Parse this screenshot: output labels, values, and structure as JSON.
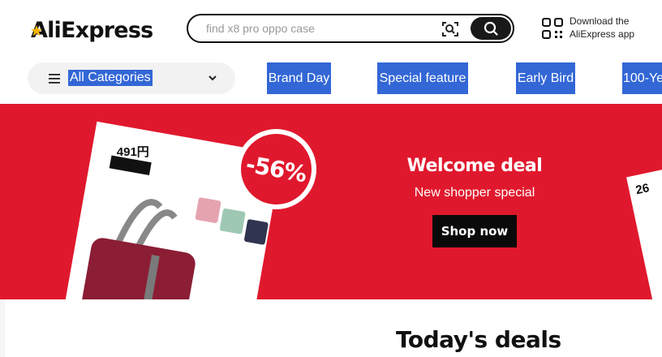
{
  "header": {
    "logo_text": "AliExpress",
    "search_placeholder": "find x8 pro oppo case",
    "download_line1": "Download the",
    "download_line2": "AliExpress app"
  },
  "nav": {
    "categories_label": "All Categories",
    "links": [
      "Brand Day",
      "Special feature",
      "Early Bird",
      "100-Ye"
    ]
  },
  "banner": {
    "price": "491円",
    "discount": "-56%",
    "title": "Welcome deal",
    "subtitle": "New shopper special",
    "cta": "Shop now",
    "next_card_price": "26"
  },
  "deals": {
    "title": "Today's deals"
  },
  "colors": {
    "brand_red": "#e0182d",
    "dark": "#191919",
    "highlight_blue": "#3367d6"
  },
  "icons": [
    "aliexpress-logo-star",
    "camera-search-icon",
    "search-icon",
    "qr-code-icon",
    "hamburger-icon",
    "chevron-down-icon"
  ]
}
